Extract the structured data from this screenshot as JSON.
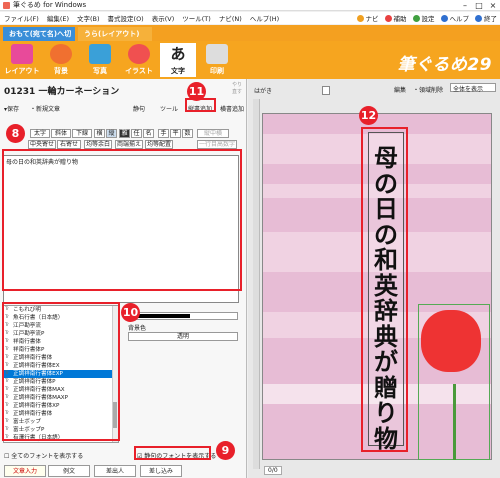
{
  "window": {
    "title": "筆ぐるめ for Windows"
  },
  "menu": {
    "items": [
      "ファイル(F)",
      "編集(E)",
      "文字(B)",
      "書式設定(O)",
      "表示(V)",
      "ツール(T)",
      "ナビ(N)",
      "ヘルプ(H)"
    ],
    "right": [
      {
        "label": "ナビ",
        "color": "#f0a020"
      },
      {
        "label": "補助",
        "color": "#e84040"
      },
      {
        "label": "設定",
        "color": "#40a040"
      },
      {
        "label": "ヘルプ",
        "color": "#3070d0"
      },
      {
        "label": "終了",
        "color": "#3070d0"
      }
    ]
  },
  "mode_tabs": {
    "front": "おもて(宛て名)へ切替",
    "back": "うら(レイアウト)"
  },
  "toolbar": {
    "buttons": [
      {
        "label": "レイアウト",
        "color": "#e84a9a"
      },
      {
        "label": "背景",
        "color": "#f07030"
      },
      {
        "label": "写真",
        "color": "#3aa0d8"
      },
      {
        "label": "イラスト",
        "color": "#f05050"
      },
      {
        "label": "文字",
        "color": "#555555"
      },
      {
        "label": "印刷",
        "color": "#9a9a9a"
      }
    ],
    "brand": "筆ぐるめ29"
  },
  "left": {
    "doc_title": "01231 一輪カーネーション",
    "undo": "やり直す",
    "save": "保存",
    "new_text": "新規文章",
    "row1": [
      "静句",
      "ツール",
      "縦書追加",
      "横書追加"
    ],
    "style_buttons": [
      "太字",
      "斜体",
      "下線",
      "横",
      "縦",
      "雅",
      "任",
      "名",
      "手",
      "平",
      "数",
      "縦中横"
    ],
    "align_buttons": [
      "中央寄せ",
      "右寄せ",
      "均等余白",
      "両端揃え",
      "均等配置",
      "一行目高数字"
    ],
    "text_value": "母の日の和英辞典が贈り物",
    "fonts": [
      "こもれび明",
      "魚石行書（日本語）",
      "江戸勘亭流",
      "江戸勘亭流P",
      "祥南行書体",
      "祥南行書体P",
      "正調祥南行書体",
      "正調祥南行書体EX",
      "正調祥南行書体EXP",
      "正調祥南行書体P",
      "正調祥南行書体MAX",
      "正調祥南行書体MAXP",
      "正調祥南行書体XP",
      "正調祥南行書体",
      "富士ボップ",
      "富士ボップP",
      "有澤行書（日本語）",
      "有澤太楷書",
      "有澤太楷書P（日本語）",
      "有澤太楷書P"
    ],
    "selected_font_index": 8,
    "color_label": "色",
    "bg_color_label": "背景色",
    "bg_color_value": "透明",
    "show_all_fonts": "全てのフォントを表示する",
    "show_phrase_fonts": "静句のフォントを表示する",
    "bottom_tabs": [
      "文章入力",
      "例文",
      "差出人",
      "差し込み"
    ]
  },
  "right": {
    "hagaki": "はがき",
    "scale_label": "編集",
    "area_clear": "領域削除",
    "view_select": "全体を表示",
    "page_counter": "0/0"
  },
  "vertical_text": [
    "母",
    "の",
    "日",
    "の",
    "和",
    "英",
    "辞",
    "典",
    "が",
    "贈",
    "り",
    "物"
  ],
  "badges": [
    "8",
    "9",
    "10",
    "11",
    "12"
  ]
}
